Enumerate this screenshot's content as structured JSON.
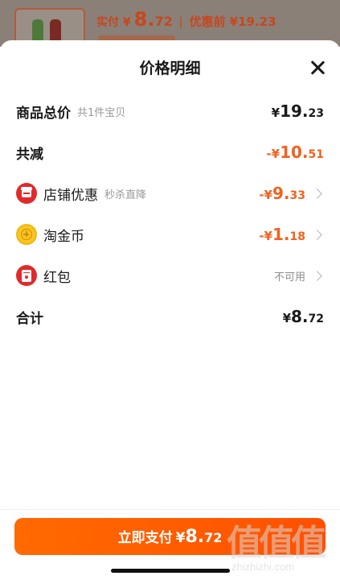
{
  "background_page": {
    "pay_prefix": "实付 ¥",
    "pay_int": "8.",
    "pay_dec": "72",
    "separator": "|",
    "before_discount": "优惠前 ¥19.23"
  },
  "sheet": {
    "title": "价格明细"
  },
  "rows": {
    "goods_total": {
      "label": "商品总价",
      "sub": "共1件宝贝",
      "yen": "¥",
      "int": "19.",
      "dec": "23"
    },
    "total_reduction": {
      "label": "共减",
      "yen": "-¥",
      "int": "10.",
      "dec": "51"
    },
    "store_discount": {
      "label": "店铺优惠",
      "sub": "秒杀直降",
      "yen": "-¥",
      "int": "9.",
      "dec": "33"
    },
    "taojinbi": {
      "label": "淘金币",
      "yen": "-¥",
      "int": "1.",
      "dec": "18"
    },
    "red_packet": {
      "label": "红包",
      "status": "不可用"
    },
    "subtotal": {
      "label": "合计",
      "yen": "¥",
      "int": "8.",
      "dec": "72"
    }
  },
  "pay_button": {
    "label": "立即支付",
    "yen": "¥",
    "int": "8.",
    "dec": "72"
  },
  "watermark": {
    "logo": "值值值",
    "text": "zhizhizhi.com"
  },
  "colors": {
    "accent_orange": "#ff5000",
    "discount_orange": "#f0621f",
    "icon_red": "#e22a2a",
    "coin_yellow": "#f7c623"
  }
}
